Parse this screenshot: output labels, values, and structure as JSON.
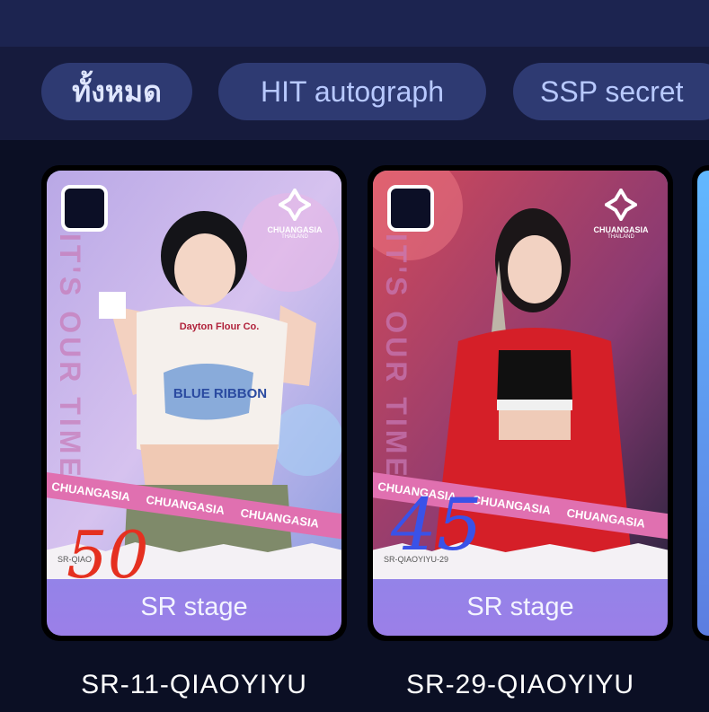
{
  "tabs": [
    {
      "label": "ทั้งหมด",
      "active": true
    },
    {
      "label": "HIT autograph",
      "active": false
    },
    {
      "label": "SSP secret",
      "active": false
    }
  ],
  "cards": [
    {
      "footer": "SR stage",
      "name": "SR-11-QIAOYIYU",
      "handwritten": "50",
      "brand": "CHUANGASIA",
      "brand_sub": "THAILAND",
      "side_text": "IT'S OUR TIME",
      "banner": "CHUANGASIA",
      "shirt_text_1": "Dayton Flour Co.",
      "shirt_text_2": "BLUE RIBBON",
      "code_partial": "SR-QIAO"
    },
    {
      "footer": "SR stage",
      "name": "SR-29-QIAOYIYU",
      "handwritten": "45",
      "brand": "CHUANGASIA",
      "brand_sub": "THAILAND",
      "side_text": "IT'S OUR TIME",
      "banner": "CHUANGASIA",
      "code_partial": "SR-QIAOYIYU-29"
    }
  ],
  "colors": {
    "topbar": "#1c2450",
    "tab_bg": "#2e3a72",
    "tab_text": "#b8c9ff",
    "page_bg": "#0b0f24",
    "handwriting_1": "#e53020",
    "handwriting_2": "#3a52e8"
  }
}
